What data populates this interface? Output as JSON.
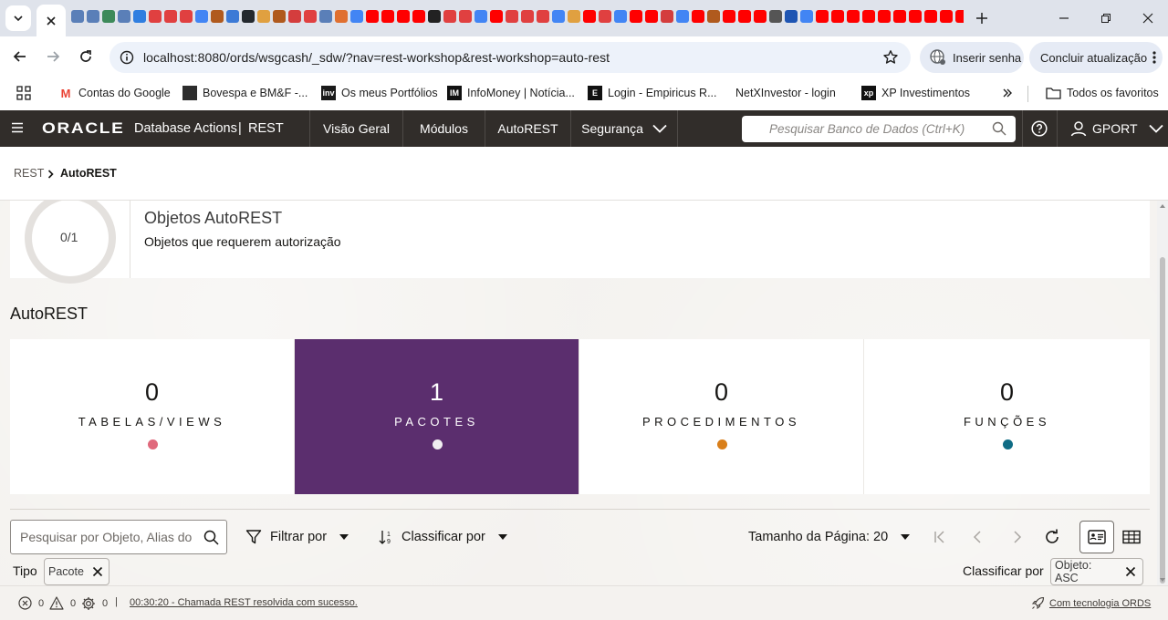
{
  "browser": {
    "address": "localhost:8080/ords/wsgcash/_sdw/?nav=rest-workshop&rest-workshop=auto-rest",
    "password_chip": "Inserir senha",
    "update_chip": "Concluir atualização",
    "favicon_colors": [
      "#5a7fb8",
      "#5a7fb8",
      "#3d8a5a",
      "#5a7fb8",
      "#2f7ee0",
      "#e04040",
      "#e04040",
      "#e04040",
      "#4285f4",
      "#b05a1e",
      "#3c7ad6",
      "#24292e",
      "#e0a040",
      "#b05a1e",
      "#d43d3d",
      "#e04040",
      "#5a7fb8",
      "#e07030",
      "#4285f4",
      "#ff0000",
      "#ff0000",
      "#ff0000",
      "#ff0000",
      "#222222",
      "#e04040",
      "#e04040",
      "#4285f4",
      "#ff0000",
      "#e04040",
      "#e04040",
      "#e04040",
      "#4285f4",
      "#e0a040",
      "#ff0000",
      "#e04040",
      "#4285f4",
      "#ff0000",
      "#ff0000",
      "#d43d3d",
      "#4285f4",
      "#ff0000",
      "#b05a1e",
      "#ff0000",
      "#ff0000",
      "#ff0000",
      "#555555",
      "#1e55b3",
      "#4285f4",
      "#ff0000",
      "#ff0000",
      "#ff0000",
      "#ff0000",
      "#ff0000",
      "#ff0000",
      "#ff0000",
      "#ff0000",
      "#ff0000",
      "#ff0000",
      "#4285f4",
      "#111111",
      "#e04040",
      "#e0a040"
    ]
  },
  "bookmarks": [
    {
      "label": "Contas do Google",
      "icon": "gmail-icon",
      "color": "#ea4335",
      "glyph": "M"
    },
    {
      "label": "Bovespa e BM&F -...",
      "icon": "chart-icon",
      "color": "#2d2d2d",
      "glyph": ""
    },
    {
      "label": "Os meus Portfólios",
      "icon": "investing-icon",
      "color": "#1a1a1a",
      "glyph": "inv"
    },
    {
      "label": "InfoMoney | Notícia...",
      "icon": "infomoney-icon",
      "color": "#111111",
      "glyph": "IM"
    },
    {
      "label": "Login - Empiricus R...",
      "icon": "empiricus-icon",
      "color": "#111111",
      "glyph": "E"
    },
    {
      "label": "NetXInvestor - login",
      "icon": "blank-page-icon",
      "color": "#ffffff",
      "glyph": ""
    },
    {
      "label": "XP Investimentos",
      "icon": "xp-icon",
      "color": "#111111",
      "glyph": "xp"
    }
  ],
  "bookmarks_all": "Todos os favoritos",
  "header": {
    "logo": "ORACLE",
    "app_name": "Database Actions",
    "separator": "|",
    "section": "REST",
    "nav": [
      "Visão Geral",
      "Módulos",
      "AutoREST",
      "Segurança"
    ],
    "search_placeholder": "Pesquisar Banco de Dados (Ctrl+K)",
    "user": "GPORT"
  },
  "breadcrumb": {
    "root": "REST",
    "current": "AutoREST"
  },
  "objects_card": {
    "gauge": "0/1",
    "title": "Objetos AutoREST",
    "subtitle": "Objetos que requerem autorização"
  },
  "section_title": "AutoREST",
  "tiles": [
    {
      "count": "0",
      "label": "TABELAS/VIEWS",
      "dot_color": "#e0697c"
    },
    {
      "count": "1",
      "label": "PACOTES",
      "dot_color": "#f0eef0"
    },
    {
      "count": "0",
      "label": "PROCEDIMENTOS",
      "dot_color": "#d97f1a"
    },
    {
      "count": "0",
      "label": "FUNÇÕES",
      "dot_color": "#0f6c85"
    }
  ],
  "filterbar": {
    "search_placeholder": "Pesquisar por Objeto, Alias do Objeto",
    "filter": "Filtrar por",
    "sort": "Classificar por",
    "page_size": "Tamanho da Página: 20"
  },
  "tags": {
    "type_label": "Tipo",
    "type_value": "Pacote",
    "sort_label": "Classificar por",
    "sort_value": "Objeto: ASC"
  },
  "statusbar": {
    "errors": "0",
    "warnings": "0",
    "tasks": "0",
    "separator": "|",
    "message": "00:30:20 - Chamada REST resolvida com sucesso.",
    "powered": "Com tecnologia ORDS"
  }
}
